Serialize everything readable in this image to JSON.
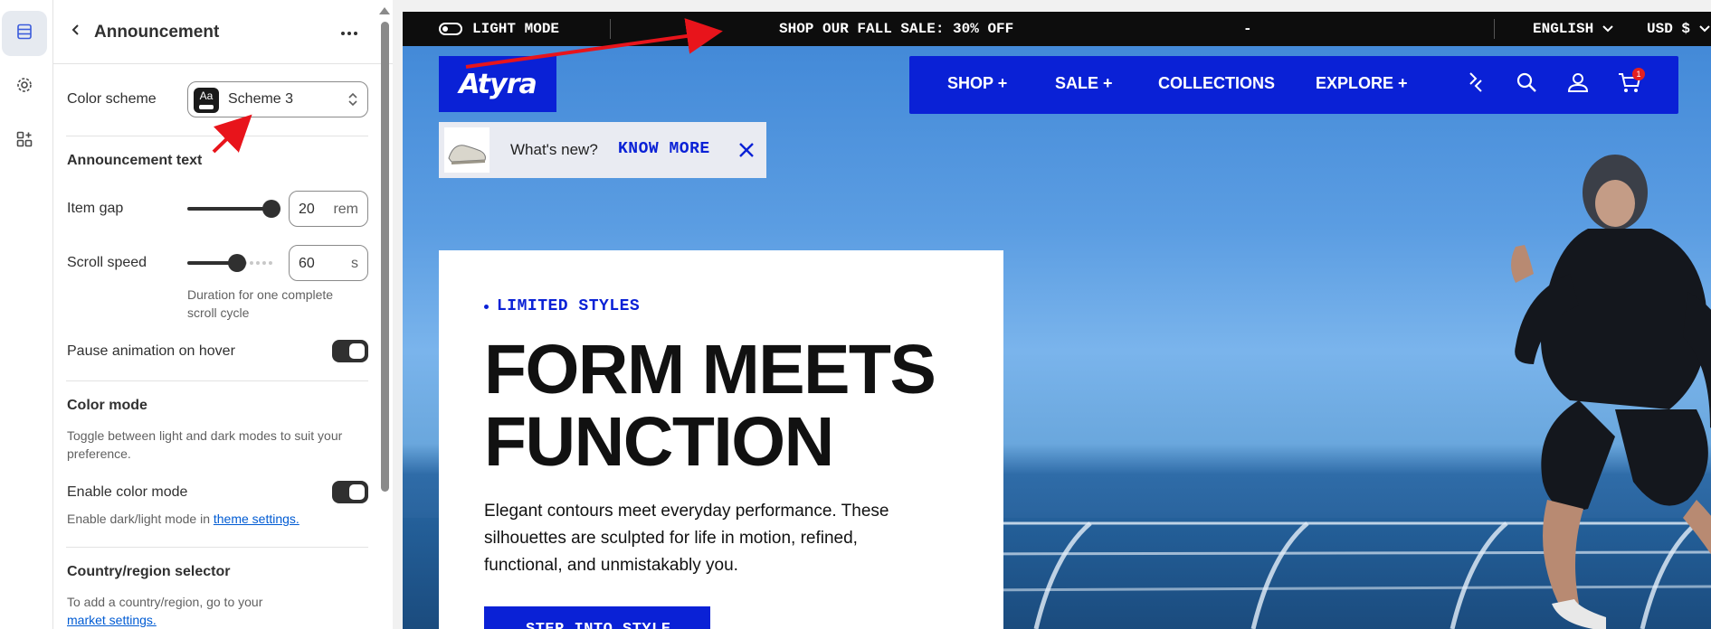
{
  "panel": {
    "title": "Announcement",
    "color_scheme_label": "Color scheme",
    "color_scheme_value": "Scheme 3",
    "scheme_swatch_text": "Aa",
    "announcement_text_heading": "Announcement text",
    "item_gap_label": "Item gap",
    "item_gap_value": "20",
    "item_gap_unit": "rem",
    "scroll_speed_label": "Scroll speed",
    "scroll_speed_value": "60",
    "scroll_speed_unit": "s",
    "scroll_speed_help_1": "Duration for one complete",
    "scroll_speed_help_2": "scroll cycle",
    "pause_label": "Pause animation on hover",
    "pause_enabled": true,
    "color_mode_heading": "Color mode",
    "color_mode_help_1": "Toggle between light and dark modes to suit your",
    "color_mode_help_2": "preference.",
    "enable_color_mode_label": "Enable color mode",
    "enable_color_mode_enabled": true,
    "color_mode_link_prefix": "Enable dark/light mode in ",
    "color_mode_link": "theme settings.",
    "country_heading": "Country/region selector",
    "country_help": "To add a country/region, go to your",
    "country_link": "market settings."
  },
  "preview": {
    "announcement": {
      "mode_label": "LIGHT MODE",
      "message": "SHOP OUR FALL SALE: 30% OFF",
      "separator": "-",
      "language": "ENGLISH",
      "currency": "USD $"
    },
    "logo": "Atyra",
    "nav": {
      "items": [
        "SHOP +",
        "SALE +",
        "COLLECTIONS",
        "EXPLORE +"
      ],
      "cart_count": "1"
    },
    "promo": {
      "question": "What's new?",
      "cta": "KNOW MORE"
    },
    "hero": {
      "eyebrow": "LIMITED STYLES",
      "headline_1": "FORM MEETS",
      "headline_2": "FUNCTION",
      "body": "Elegant contours meet everyday performance. These silhouettes are sculpted for life in motion, refined, functional, and unmistakably you.",
      "cta": "STEP INTO STYLE"
    }
  },
  "colors": {
    "brand_blue": "#0a21d6",
    "annotation_arrow": "#e8141b",
    "announcement_bg": "#0d0d0d"
  },
  "icons": [
    "sections-icon",
    "gear-icon",
    "apps-icon",
    "chevron-left-icon",
    "more-icon",
    "chevron-updown-icon",
    "toggle-icon",
    "chevron-down-icon",
    "compare-icon",
    "search-icon",
    "account-icon",
    "cart-icon",
    "close-icon"
  ]
}
